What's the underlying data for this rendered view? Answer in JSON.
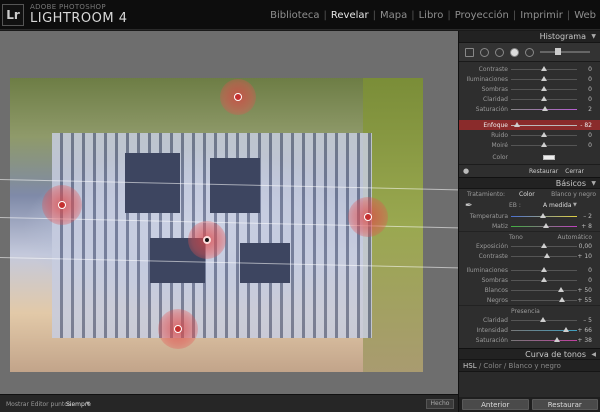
{
  "header": {
    "logo": "Lr",
    "brand_small": "ADOBE PHOTOSHOP",
    "brand_big": "LIGHTROOM 4",
    "nav": [
      "Biblioteca",
      "Revelar",
      "Mapa",
      "Libro",
      "Proyección",
      "Imprimir",
      "Web"
    ],
    "active_module": "Revelar"
  },
  "local_adjust_panel": {
    "title": "Histograma",
    "rows": [
      {
        "label": "Contraste",
        "value": "0",
        "pos": 0.5
      },
      {
        "label": "Iluminaciones",
        "value": "0",
        "pos": 0.5
      },
      {
        "label": "Sombras",
        "value": "0",
        "pos": 0.5
      },
      {
        "label": "Claridad",
        "value": "0",
        "pos": 0.5
      },
      {
        "label": "Saturación",
        "value": "2",
        "pos": 0.52
      },
      {
        "label": "Enfoque",
        "value": "- 82",
        "pos": 0.09
      },
      {
        "label": "Ruido",
        "value": "0",
        "pos": 0.5
      },
      {
        "label": "Moiré",
        "value": "0",
        "pos": 0.5
      }
    ],
    "highlight_row_index": 5,
    "color_label": "Color",
    "restore_label": "Restaurar",
    "close_label": "Cerrar"
  },
  "basic_panel": {
    "title": "Básicos",
    "treatment_label": "Tratamiento:",
    "treatment_color": "Color",
    "treatment_bw": "Blanco y negro",
    "wb_label": "EB :",
    "wb_value": "A medida",
    "temp_rows": [
      {
        "label": "Temperatura",
        "value": "– 2",
        "pos": 0.49
      },
      {
        "label": "Matiz",
        "value": "+ 8",
        "pos": 0.53
      }
    ],
    "tone_label": "Tono",
    "tone_auto": "Automático",
    "tone_rows": [
      {
        "label": "Exposición",
        "value": "0,00",
        "pos": 0.5
      },
      {
        "label": "Contraste",
        "value": "+ 10",
        "pos": 0.55
      }
    ],
    "light_rows": [
      {
        "label": "Iluminaciones",
        "value": "0",
        "pos": 0.5
      },
      {
        "label": "Sombras",
        "value": "0",
        "pos": 0.5
      },
      {
        "label": "Blancos",
        "value": "+ 50",
        "pos": 0.75
      },
      {
        "label": "Negros",
        "value": "+ 55",
        "pos": 0.77
      }
    ],
    "presence_label": "Presencia",
    "presence_rows": [
      {
        "label": "Claridad",
        "value": "– 5",
        "pos": 0.48
      },
      {
        "label": "Intensidad",
        "value": "+ 66",
        "pos": 0.83
      },
      {
        "label": "Saturación",
        "value": "+ 38",
        "pos": 0.69
      }
    ]
  },
  "tone_curve_title": "Curva de tonos",
  "hsl_bar": {
    "hsl": "HSL",
    "color": "Color",
    "bw": "Blanco y negro"
  },
  "bottom_buttons": {
    "previous": "Anterior",
    "reset": "Restaurar"
  },
  "toolbar": {
    "show_pins_label": "Mostrar Editor puntos:",
    "show_pins_value": "Siempre",
    "done_label": "Hecho"
  }
}
